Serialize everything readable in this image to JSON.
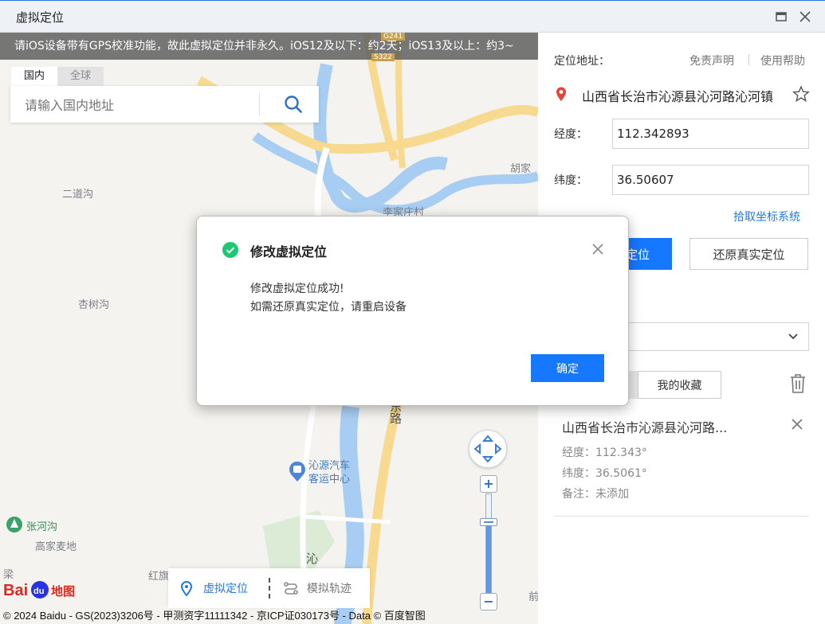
{
  "window": {
    "title": "虚拟定位"
  },
  "map": {
    "marquee": "请iOS设备带有GPS校准功能，故此虚拟定位并非永久。iOS12及以下：约2天；iOS13及以上：约3~",
    "search_tabs": [
      "国内",
      "全球"
    ],
    "search_placeholder": "请输入国内地址",
    "labels": {
      "erdaogou": "二道沟",
      "xingshugou": "杏树沟",
      "lijiazhuang": "李家庄村",
      "hujia": "胡家",
      "zhanghegou": "张河沟",
      "gaojiamaidi": "高家麦地",
      "qinyuan_bus": "沁源汽车\n客运中心",
      "hongliang": "红旗",
      "dongroad": "东路",
      "qin": "沁",
      "liang": "梁",
      "qian": "前",
      "g241": "G241",
      "s322": "S322"
    },
    "mode_virtual": "虚拟定位",
    "mode_track": "模拟轨迹",
    "zoom_level": 0.72,
    "baidu_logo": "Bai地图",
    "copyright": "© 2024 Baidu - GS(2023)3206号 - 甲测资字11111342 - 京ICP证030173号 - Data © 百度智图"
  },
  "panel": {
    "location_label": "定位地址：",
    "disclaimer": "免责声明",
    "help": "使用帮助",
    "address": "山西省长治市沁源县沁河路沁河镇",
    "lng_label": "经度：",
    "lng_value": "112.342893",
    "lat_label": "纬度：",
    "lat_value": "36.50607",
    "pick_coords": "拾取坐标系统",
    "modify_btn": "定位",
    "restore_btn": "还原真实定位",
    "favorites_tab": "我的收藏",
    "card": {
      "title": "山西省长治市沁源县沁河路...",
      "lng": "经度：112.343°",
      "lat": "纬度：36.5061°",
      "note": "备注：未添加"
    }
  },
  "modal": {
    "title": "修改虚拟定位",
    "line1": "修改虚拟定位成功!",
    "line2": "如需还原真实定位，请重启设备",
    "ok": "确定"
  },
  "colors": {
    "accent": "#1677ff",
    "success": "#1ec773",
    "pin": "#e8413c"
  }
}
